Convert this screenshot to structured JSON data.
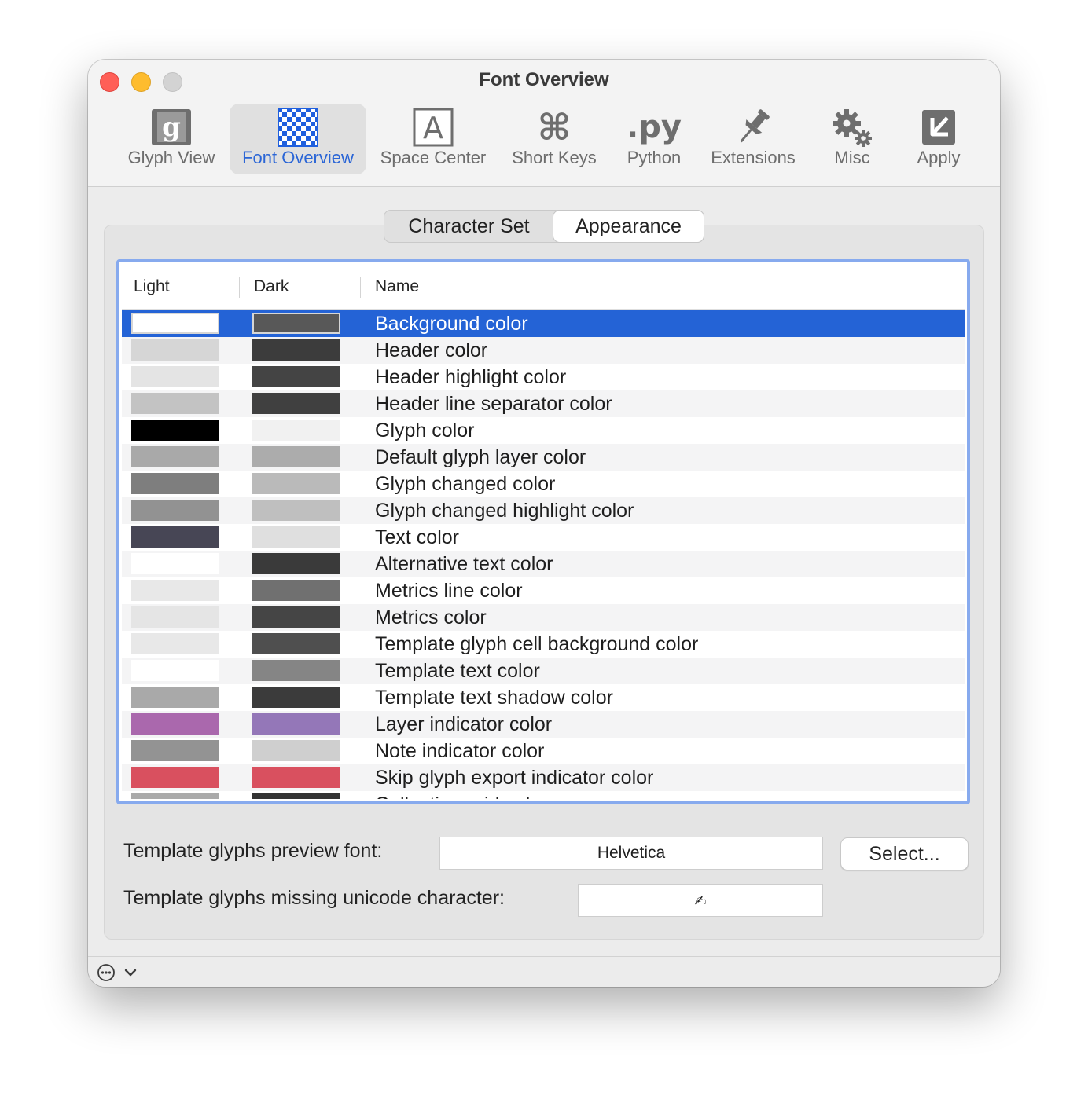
{
  "window": {
    "title": "Font Overview"
  },
  "toolbar": {
    "items": [
      {
        "label": "Glyph View",
        "icon": "glyph-view-icon",
        "selected": false
      },
      {
        "label": "Font Overview",
        "icon": "font-overview-icon",
        "selected": true
      },
      {
        "label": "Space Center",
        "icon": "space-center-icon",
        "selected": false
      },
      {
        "label": "Short Keys",
        "icon": "command-key-icon",
        "selected": false
      },
      {
        "label": "Python",
        "icon": "python-icon",
        "selected": false
      },
      {
        "label": "Extensions",
        "icon": "pushpin-icon",
        "selected": false
      },
      {
        "label": "Misc",
        "icon": "gears-icon",
        "selected": false
      },
      {
        "label": "Apply",
        "icon": "apply-icon",
        "selected": false
      }
    ]
  },
  "tabs": {
    "items": [
      "Character Set",
      "Appearance"
    ],
    "selected": "Appearance"
  },
  "table": {
    "columns": [
      "Light",
      "Dark",
      "Name"
    ],
    "rows": [
      {
        "light": "#ffffff",
        "dark": "#585858",
        "name": "Background color",
        "selected": true
      },
      {
        "light": "#d6d6d6",
        "dark": "#3c3c3c",
        "name": "Header color"
      },
      {
        "light": "#e4e4e4",
        "dark": "#444444",
        "name": "Header highlight color"
      },
      {
        "light": "#c3c3c3",
        "dark": "#404040",
        "name": "Header line separator color"
      },
      {
        "light": "#000000",
        "dark": "#f1f1f1",
        "name": "Glyph color"
      },
      {
        "light": "#a9a9a9",
        "dark": "#acacac",
        "name": "Default glyph layer color"
      },
      {
        "light": "#7e7e7e",
        "dark": "#bababa",
        "name": "Glyph changed color"
      },
      {
        "light": "#929292",
        "dark": "#bfbfbf",
        "name": "Glyph changed highlight color"
      },
      {
        "light": "#474655",
        "dark": "#dfdfdf",
        "name": "Text color"
      },
      {
        "light": "#ffffff",
        "dark": "#3a3a3a",
        "name": "Alternative text color"
      },
      {
        "light": "#e8e8e8",
        "dark": "#707070",
        "name": "Metrics line color"
      },
      {
        "light": "#e5e5e5",
        "dark": "#454545",
        "name": "Metrics color"
      },
      {
        "light": "#e8e8e8",
        "dark": "#4f4f4f",
        "name": "Template glyph cell background color"
      },
      {
        "light": "#ffffff",
        "dark": "#858585",
        "name": "Template text color"
      },
      {
        "light": "#a9a9a9",
        "dark": "#3b3b3b",
        "name": "Template text shadow color"
      },
      {
        "light": "#aa68ad",
        "dark": "#9477b8",
        "name": "Layer indicator color"
      },
      {
        "light": "#939393",
        "dark": "#cfcfcf",
        "name": "Note indicator color"
      },
      {
        "light": "#d9505f",
        "dark": "#d9505f",
        "name": "Skip glyph export indicator color"
      },
      {
        "light": "#aaaaaa",
        "dark": "#333333",
        "name": "Collection grid color"
      }
    ]
  },
  "form": {
    "preview_font_label": "Template glyphs preview font:",
    "preview_font_value": "Helvetica",
    "select_button": "Select...",
    "missing_char_label": "Template glyphs missing unicode character:",
    "missing_char_value": "✍"
  },
  "bottombar": {
    "action_icon": "more-icon",
    "chevron_icon": "chevron-down-icon"
  },
  "colors": {
    "selection": "#2463d6",
    "focus_ring": "#87aaee",
    "accent_label": "#2a65d6"
  }
}
